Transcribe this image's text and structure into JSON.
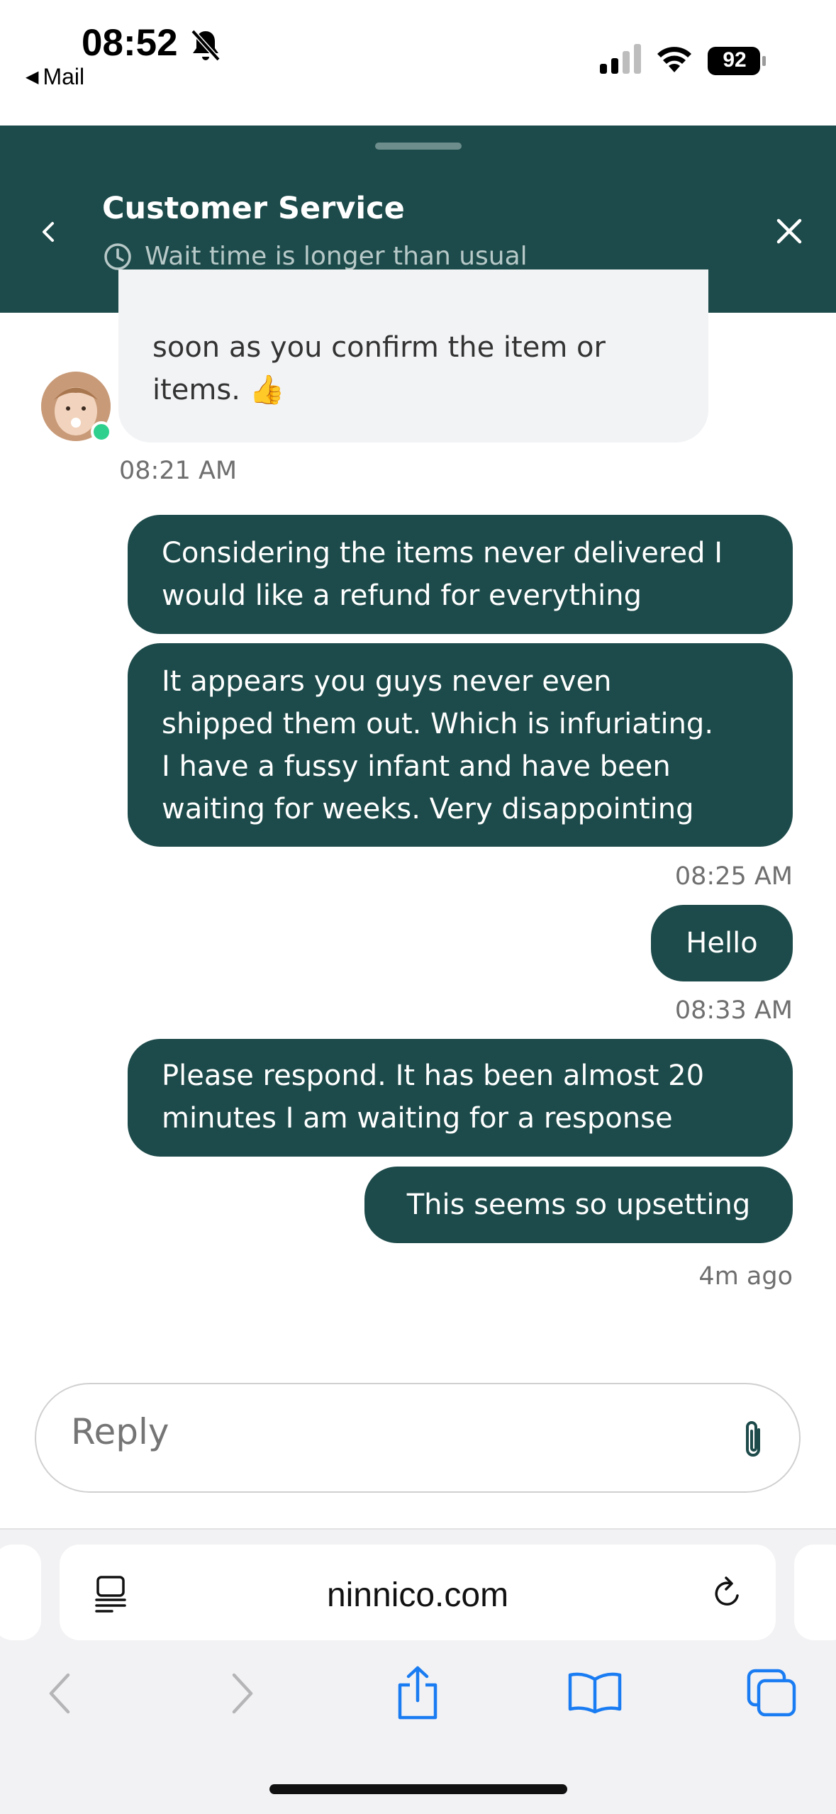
{
  "status_bar": {
    "time": "08:52",
    "back_app": "Mail",
    "battery": "92"
  },
  "header": {
    "title": "Customer Service",
    "subtitle": "Wait time is longer than usual"
  },
  "messages": [
    {
      "from": "agent",
      "lines": [
        "soon as you confirm the item or",
        "items. 👍"
      ]
    },
    {
      "from": "timestamp",
      "text": "08:21 AM"
    },
    {
      "from": "me",
      "lines": [
        "Considering the items never delivered I",
        "would like a refund for everything"
      ]
    },
    {
      "from": "me",
      "lines": [
        "It appears you guys never even",
        "shipped them out. Which is infuriating.",
        "I have a fussy infant and have been",
        "waiting for weeks. Very disappointing"
      ]
    },
    {
      "from": "timestamp",
      "text": "08:25 AM"
    },
    {
      "from": "me",
      "lines": [
        "Hello"
      ]
    },
    {
      "from": "timestamp",
      "text": "08:33 AM"
    },
    {
      "from": "me",
      "lines": [
        "Please respond. It has been almost 20",
        "minutes I am waiting for a response"
      ]
    },
    {
      "from": "me",
      "lines": [
        "This seems so upsetting"
      ]
    },
    {
      "from": "timestamp",
      "text": "4m ago"
    }
  ],
  "reply": {
    "placeholder": "Reply"
  },
  "browser": {
    "url": "ninnico.com"
  },
  "colors": {
    "accent": "#1d4a4a",
    "online": "#2fd08e",
    "ios_blue": "#1a7cf2"
  }
}
